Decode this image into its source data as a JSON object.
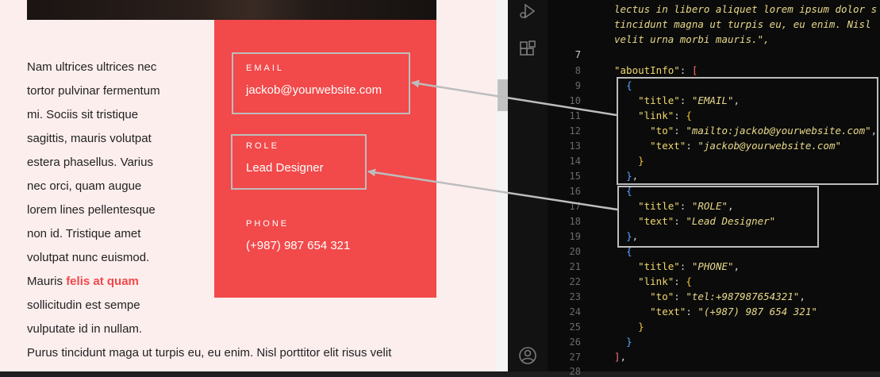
{
  "website": {
    "paragraph_lines": [
      "Nam ultrices ultrices nec",
      "tortor pulvinar fermentum",
      "mi. Sociis sit tristique",
      "sagittis, mauris volutpat",
      "estera phasellus. Varius",
      "nec orci, quam augue",
      "lorem lines pellentesque",
      "non id. Tristique amet",
      "volutpat nunc euismod."
    ],
    "paragraph_mauris": "Mauris ",
    "paragraph_highlight": "felis at quam",
    "paragraph_after": [
      "sollicitudin est sempe",
      "vulputate id in nullam."
    ],
    "paragraph_last": "Purus tincidunt maga ut turpis eu, eu enim. Nisl porttitor elit risus velit",
    "about": [
      {
        "title": "EMAIL",
        "value": "jackob@yourwebsite.com"
      },
      {
        "title": "ROLE",
        "value": "Lead Designer"
      },
      {
        "title": "PHONE",
        "value": "(+987) 987 654 321"
      }
    ]
  },
  "editor": {
    "top_lines": [
      "lectus in libero aliquet lorem ipsum dolor s",
      "tincidunt magna ut turpis eu, eu enim. Nisl",
      "velit urna morbi mauris.\","
    ],
    "line_numbers": [
      "7",
      "8",
      "9",
      "10",
      "11",
      "12",
      "13",
      "14",
      "15",
      "16",
      "17",
      "18",
      "19",
      "20",
      "21",
      "22",
      "23",
      "24",
      "25",
      "26",
      "27",
      "28"
    ],
    "current_line": "7",
    "keys": {
      "aboutInfo": "\"aboutInfo\"",
      "title": "\"title\"",
      "link": "\"link\"",
      "to": "\"to\"",
      "text": "\"text\""
    },
    "values": {
      "email_title": "\"EMAIL\"",
      "email_to": "\"mailto:jackob@yourwebsite.com\"",
      "email_text": "\"jackob@yourwebsite.com\"",
      "role_title": "\"ROLE\"",
      "role_text": "\"Lead Designer\"",
      "phone_title": "\"PHONE\"",
      "phone_to": "\"tel:+987987654321\"",
      "phone_text": "\"(+987) 987 654 321\""
    }
  },
  "colors": {
    "accent": "#f2494a",
    "page_bg": "#fdeeee",
    "editor_bg": "#0b0b0b",
    "annotation": "#bdbdbd"
  },
  "icons": [
    "run-debug-icon",
    "extensions-icon",
    "account-icon"
  ]
}
